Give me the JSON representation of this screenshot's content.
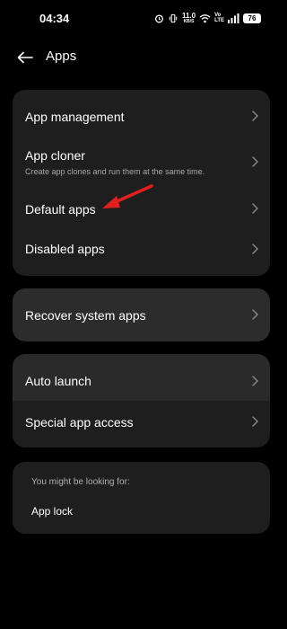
{
  "status_bar": {
    "time": "04:34",
    "net_speed_value": "11.0",
    "net_speed_unit": "KB/S",
    "volte_top": "Vo",
    "volte_bottom": "LTE",
    "battery": "76"
  },
  "header": {
    "title": "Apps"
  },
  "card1": {
    "app_management": "App management",
    "app_cloner": "App cloner",
    "app_cloner_sub": "Create app clones and run them at the same time.",
    "default_apps": "Default apps",
    "disabled_apps": "Disabled apps"
  },
  "card2": {
    "recover_system_apps": "Recover system apps"
  },
  "card3": {
    "auto_launch": "Auto launch",
    "special_app_access": "Special app access"
  },
  "card4": {
    "hint": "You might be looking for:",
    "app_lock": "App lock"
  },
  "colors": {
    "background": "#000000",
    "card": "#1e1e1e",
    "card_highlight": "#2c2c2c",
    "annotation_arrow": "#e02020"
  }
}
